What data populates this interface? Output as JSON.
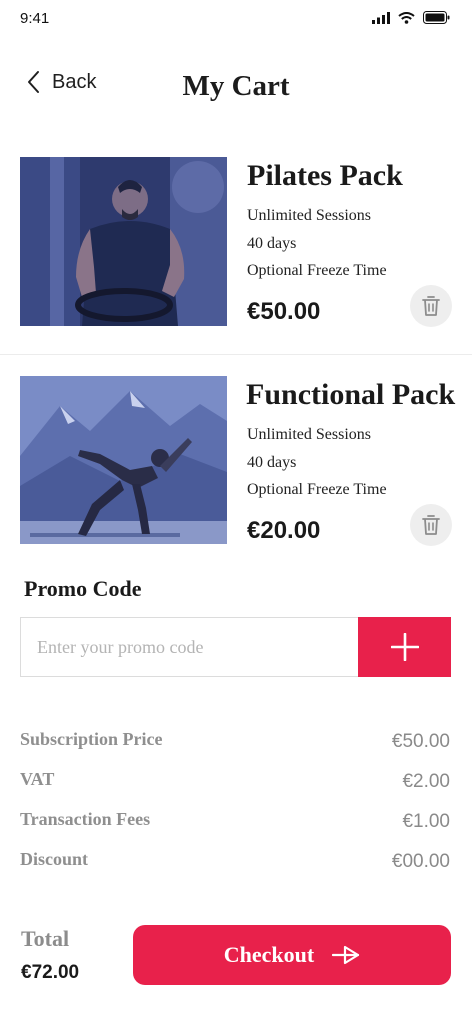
{
  "status_bar": {
    "time": "9:41"
  },
  "nav": {
    "back_label": "Back",
    "title": "My Cart"
  },
  "cart_items": [
    {
      "name": "Pilates Pack",
      "details": [
        "Unlimited Sessions",
        "40 days",
        "Optional Freeze Time"
      ],
      "price": "€50.00"
    },
    {
      "name": "Functional Pack",
      "details": [
        "Unlimited Sessions",
        "40 days",
        "Optional Freeze Time"
      ],
      "price": "€20.00"
    }
  ],
  "promo": {
    "title": "Promo Code",
    "placeholder": "Enter your promo code"
  },
  "summary": [
    {
      "label": "Subscription Price",
      "value": "€50.00"
    },
    {
      "label": "VAT",
      "value": "€2.00"
    },
    {
      "label": "Transaction Fees",
      "value": "€1.00"
    },
    {
      "label": "Discount",
      "value": "€00.00"
    }
  ],
  "total": {
    "label": "Total",
    "value": "€72.00"
  },
  "checkout": {
    "label": "Checkout"
  },
  "colors": {
    "accent": "#e8214b",
    "muted_text": "#8f8f8f",
    "image_tint": "#3a4f9a"
  }
}
